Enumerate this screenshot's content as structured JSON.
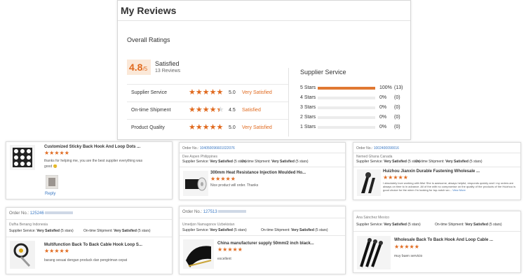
{
  "page_title": "My Reviews",
  "overall": {
    "title": "Overall Ratings",
    "score": "4.8",
    "score_suffix": "/5",
    "satisfaction": "Satisfied",
    "review_count": "13 Reviews"
  },
  "ratings": [
    {
      "label": "Supplier Service",
      "stars": "★★★★★",
      "value": "5.0",
      "desc": "Very Satisfied"
    },
    {
      "label": "On-time Shipment",
      "stars": "★★★★★",
      "value": "4.5",
      "desc": "Satisfied"
    },
    {
      "label": "Product Quality",
      "stars": "★★★★★",
      "value": "5.0",
      "desc": "Very Satisfied"
    }
  ],
  "supplier_service": {
    "title": "Supplier Service",
    "rows": [
      {
        "label": "5 Stars",
        "percent": "100%",
        "fill": 1.0,
        "count": "(13)"
      },
      {
        "label": "4 Stars",
        "percent": "0%",
        "fill": 0,
        "count": "(0)"
      },
      {
        "label": "3 Stars",
        "percent": "0%",
        "fill": 0,
        "count": "(0)"
      },
      {
        "label": "2 Stars",
        "percent": "0%",
        "fill": 0,
        "count": "(0)"
      },
      {
        "label": "1 Stars",
        "percent": "0%",
        "fill": 0,
        "count": "(0)"
      }
    ]
  },
  "colors": {
    "accent": "#e06a1f",
    "bar": "#e07833",
    "link": "#3a78c3",
    "score_bg": "#fbe8d8"
  },
  "reviews": {
    "r1": {
      "title": "Customized Sticky Back Hook And Loop Dots ...",
      "stars": "★★★★★",
      "text": "thanks for helping me, you are the best supplier everything was good 😊",
      "reply": "Reply"
    },
    "r2": {
      "order_prefix": "Order No.:",
      "order_no": "104050096601022076",
      "buyer": "Dee Aspen Philippines",
      "supplier_label": "Supplier Service:",
      "supplier_value": "Very Satisfied",
      "supplier_stars": "(5 stars)",
      "ontime_label": "On-time Shipment:",
      "ontime_value": "Very Satisfied",
      "ontime_stars": "(5 stars)",
      "title": "300mm Heat Resistance Injection Moulded Ho...",
      "stars": "★★★★★",
      "text": "Nice product will order. Thanks"
    },
    "r3": {
      "order_prefix": "Order No.:",
      "order_no": "1002400090016",
      "buyer": "Nemed Ghana Canada",
      "supplier_label": "Supplier Service:",
      "supplier_value": "Very Satisfied",
      "supplier_stars": "(5 stars)",
      "ontime_label": "On-time Shipment:",
      "ontime_value": "Very Satisfied",
      "ontime_stars": "(5 stars)",
      "title": "Huizhou Jianxin Durable Fastening Wholesale ...",
      "stars": "★★★★★",
      "text": "I absolutely love working with Mia! She is awesome, always helpful, responds quickly and I my orders are always on time to in advance. All of the with no compromise on the quality of the products of the Huizhou is good choice for the when I'm looking for top-notch wo...",
      "view_more": "View More"
    },
    "r4": {
      "order_prefix": "Order No.:",
      "order_no": "125246",
      "buyer": "Dufha Benang Indonesia",
      "supplier_label": "Supplier Service:",
      "supplier_value": "Very Satisfied",
      "supplier_stars": "(5 stars)",
      "ontime_label": "On-time Shipment:",
      "ontime_value": "Very Satisfied",
      "ontime_stars": "(5 stars)",
      "title": "Multifunction Back To Back Cable Hook Loop S...",
      "stars": "★★★★★",
      "text": "barang sesuai dengan produck dan pengiriman cepat"
    },
    "r5": {
      "order_prefix": "Order No.:",
      "order_no": "127513",
      "buyer": "Umedjon Namagonov Uzbekistan",
      "supplier_label": "Supplier Service:",
      "supplier_value": "Very Satisfied",
      "supplier_stars": "(5 stars)",
      "ontime_label": "On-time Shipment:",
      "ontime_value": "Very Satisfied",
      "ontime_stars": "(5 stars)",
      "title": "China manufacturer supply 50mm/2 inch black...",
      "stars": "★★★★★",
      "text": "excellent"
    },
    "r6": {
      "buyer": "Ana Sánchez Mexico",
      "supplier_label": "Supplier Service:",
      "supplier_value": "Very Satisfied",
      "supplier_stars": "(5 stars)",
      "ontime_label": "On-time Shipment:",
      "ontime_value": "Very Satisfied",
      "ontime_stars": "(5 stars)",
      "title": "Wholesale Back To Back Hook And Loop Cable ...",
      "stars": "★★★★★",
      "text": "muy buen servicio"
    }
  }
}
